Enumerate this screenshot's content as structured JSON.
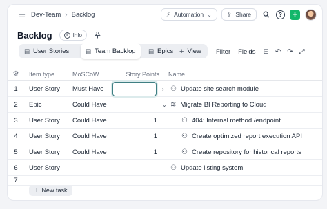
{
  "breadcrumb": {
    "team": "Dev-Team",
    "page": "Backlog"
  },
  "header": {
    "automation_label": "Automation",
    "share_label": "Share",
    "colors": {
      "add": "#12b76a"
    }
  },
  "page": {
    "title": "Backlog",
    "info_label": "Info"
  },
  "tabs": [
    {
      "label": "User Stories"
    },
    {
      "label": "Team Backlog"
    },
    {
      "label": "Epics"
    },
    {
      "label": "View"
    }
  ],
  "toolbar": {
    "filter_label": "Filter",
    "fields_label": "Fields"
  },
  "table": {
    "columns": [
      "Item type",
      "MoSCoW",
      "Story Points",
      "Name"
    ],
    "rows": [
      {
        "num": "1",
        "type": "User Story",
        "moscow": "Must Have",
        "points": "",
        "name": "Update site search module",
        "expander": "›",
        "icon": "user-group"
      },
      {
        "num": "2",
        "type": "Epic",
        "moscow": "Could Have",
        "points": "",
        "name": "Migrate BI Reporting to Cloud",
        "expander": "⌄",
        "icon": "layers"
      },
      {
        "num": "3",
        "type": "User Story",
        "moscow": "Could Have",
        "points": "1",
        "name": "404: Internal method /endpoint",
        "icon": "user-group"
      },
      {
        "num": "4",
        "type": "User Story",
        "moscow": "Could Have",
        "points": "1",
        "name": "Create optimized report execution API",
        "icon": "user-group"
      },
      {
        "num": "5",
        "type": "User Story",
        "moscow": "Could Have",
        "points": "1",
        "name": "Create repository for historical reports",
        "icon": "user-group"
      },
      {
        "num": "6",
        "type": "User Story",
        "moscow": "",
        "points": "",
        "name": "Update listing system",
        "icon": "user-group"
      },
      {
        "num": "7",
        "type": "",
        "moscow": "",
        "points": "",
        "name": ""
      }
    ]
  },
  "footer": {
    "new_task_label": "New task"
  }
}
